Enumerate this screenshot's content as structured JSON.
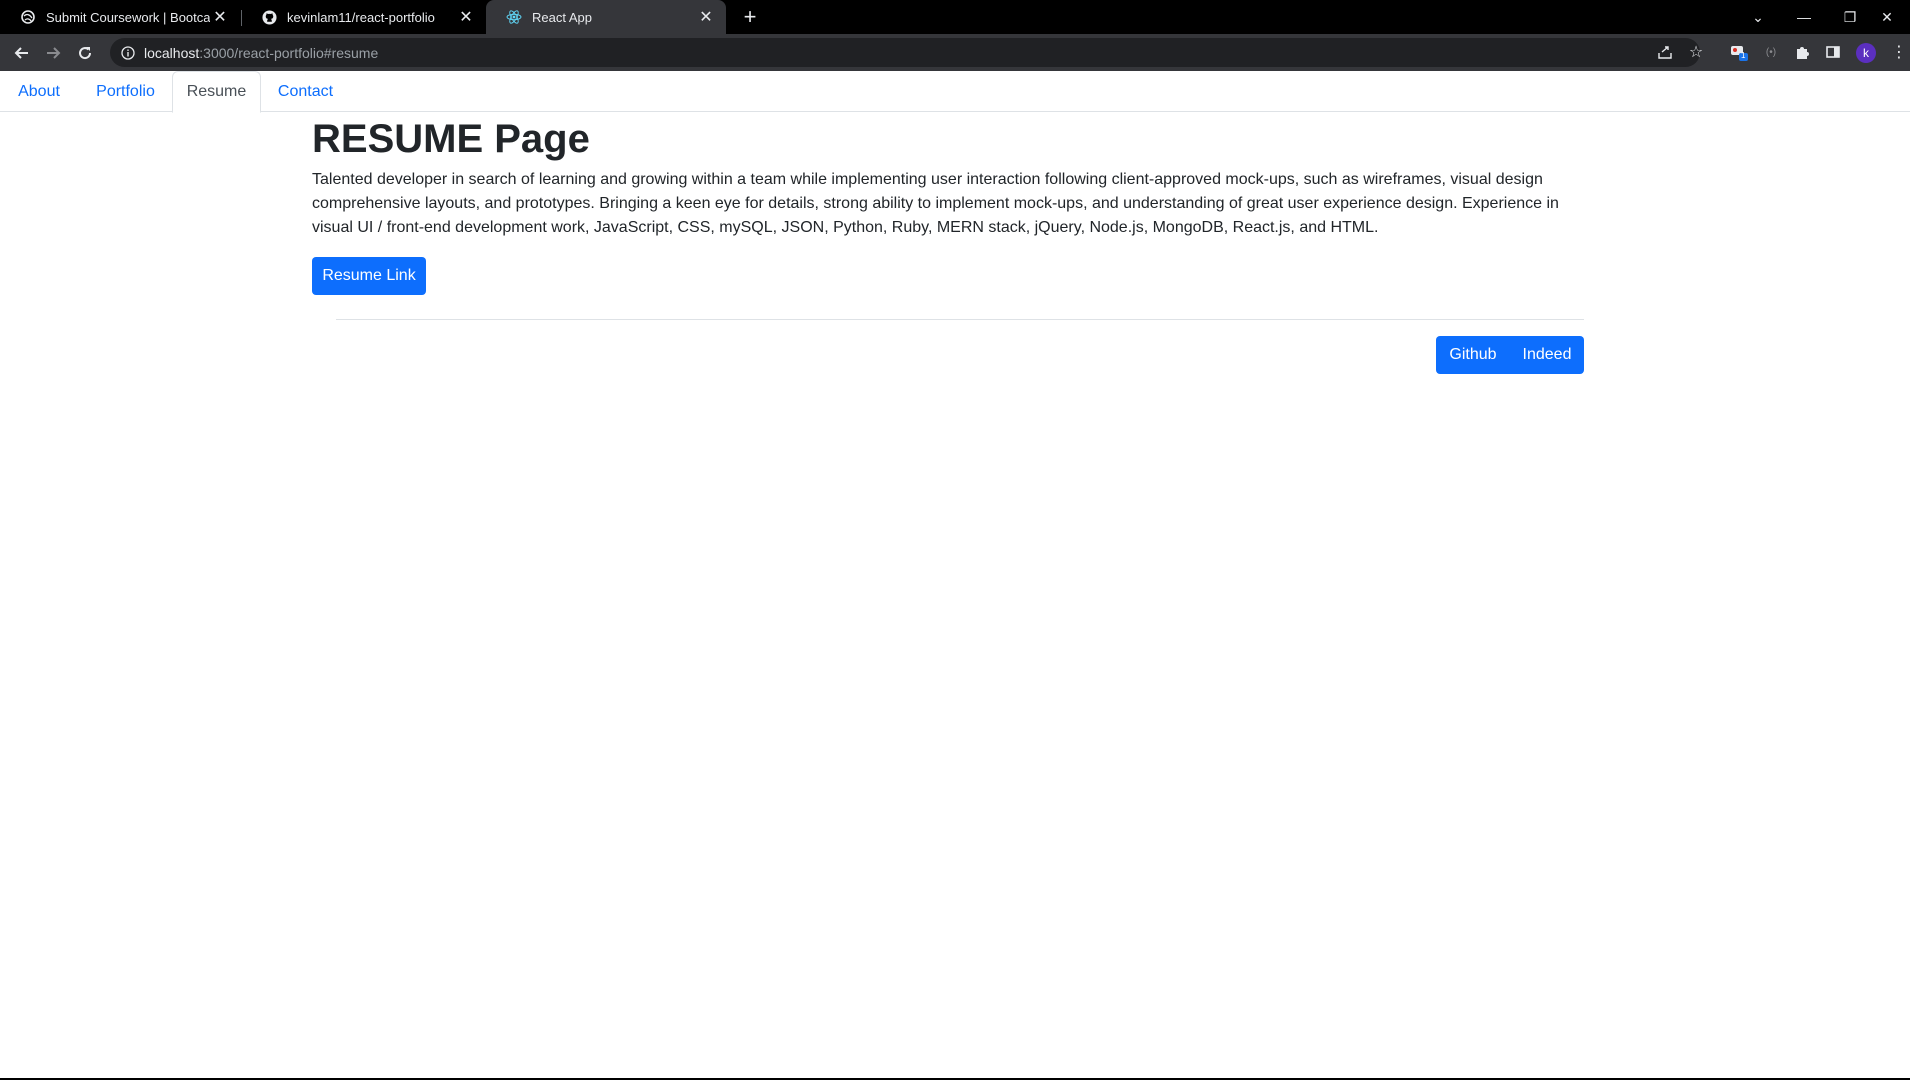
{
  "browser": {
    "tabs": [
      {
        "title": "Submit Coursework | Bootcamp S",
        "favicon": "bootcamp-favicon-icon"
      },
      {
        "title": "kevinlam11/react-portfolio",
        "favicon": "github-favicon-icon"
      },
      {
        "title": "React App",
        "favicon": "react-favicon-icon"
      }
    ],
    "active_tab": 2,
    "url_host": "localhost",
    "url_rest": ":3000/react-portfolio#resume",
    "profile_initial": "k",
    "extension_badge": "1"
  },
  "nav": {
    "tabs": [
      {
        "label": "About"
      },
      {
        "label": "Portfolio"
      },
      {
        "label": "Resume"
      },
      {
        "label": "Contact"
      }
    ],
    "active": "Resume"
  },
  "main": {
    "title": "RESUME Page",
    "bio": "Talented developer in search of learning and growing within a team while implementing user interaction following client-approved mock-ups, such as wireframes, visual design comprehensive layouts, and prototypes. Bringing a keen eye for details, strong ability to implement mock-ups, and understanding of great user experience design. Experience in visual UI / front-end development work, JavaScript, CSS, mySQL, JSON, Python, Ruby, MERN stack, jQuery, Node.js, MongoDB, React.js, and HTML.",
    "resume_button": "Resume Link"
  },
  "footer": {
    "links": [
      {
        "label": "Github"
      },
      {
        "label": "Indeed"
      }
    ]
  },
  "colors": {
    "primary": "#0d6efd",
    "tab_bar": "#000000",
    "toolbar": "#35363a"
  }
}
